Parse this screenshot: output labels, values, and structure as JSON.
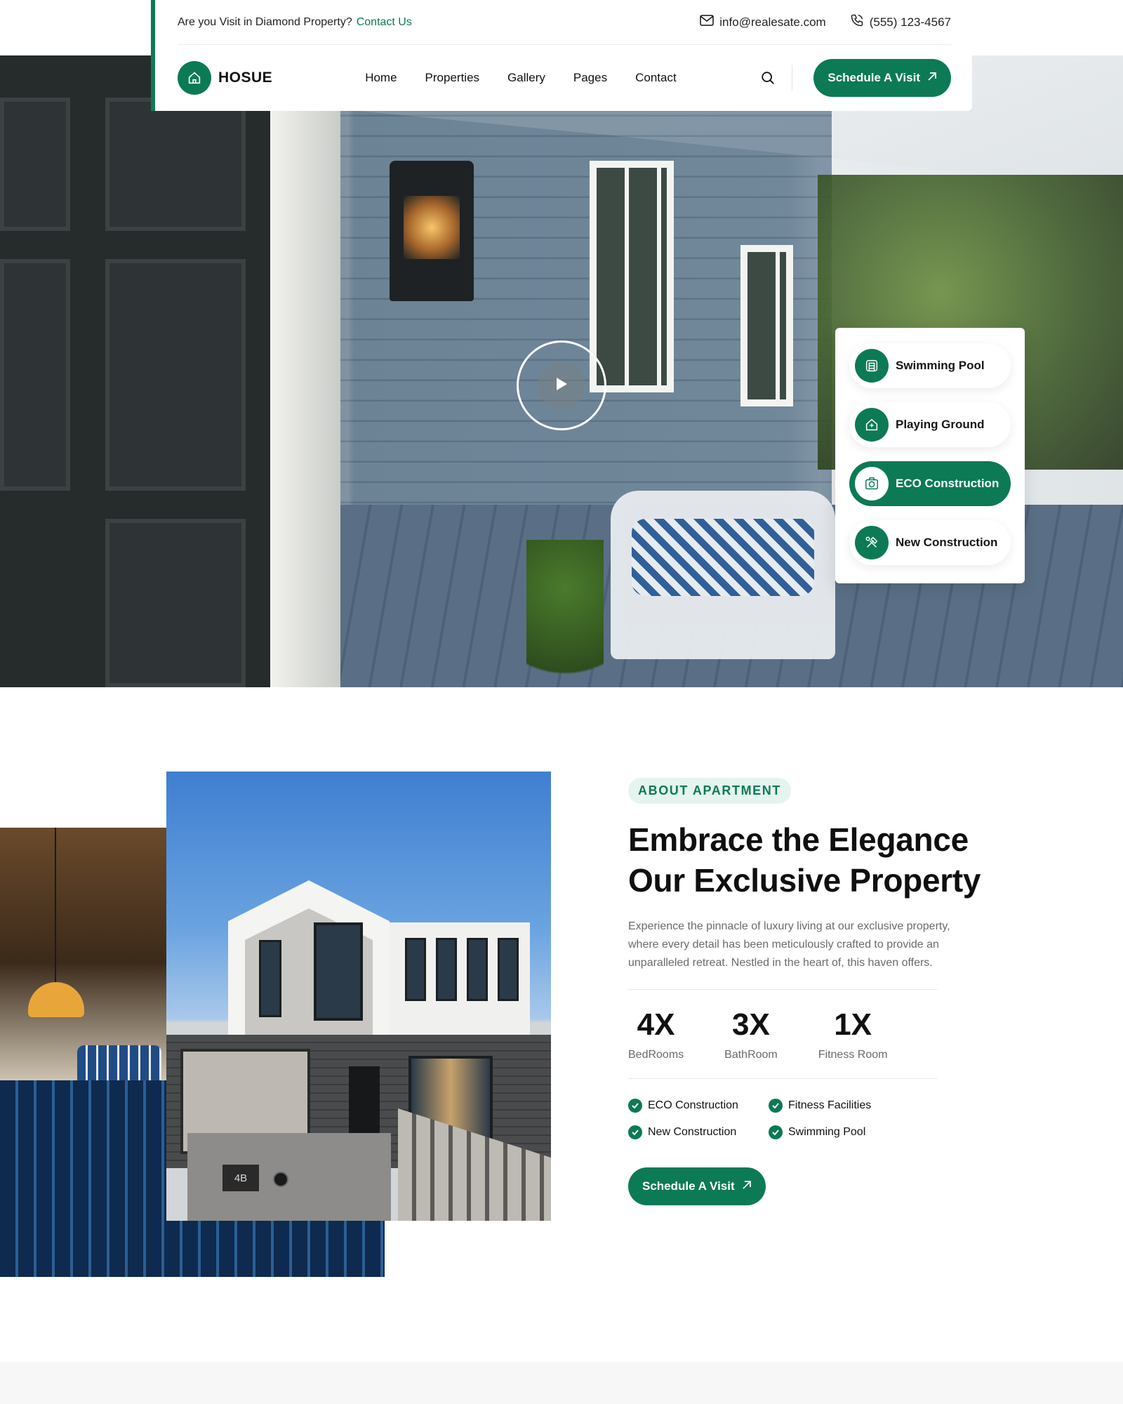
{
  "topbar": {
    "question": "Are you Visit in Diamond Property?",
    "contact_link": "Contact Us",
    "email": "info@realesate.com",
    "phone": "(555) 123-4567"
  },
  "header": {
    "logo_text": "HOSUE",
    "nav": [
      "Home",
      "Properties",
      "Gallery",
      "Pages",
      "Contact"
    ],
    "cta": "Schedule A Visit"
  },
  "hero": {
    "features": [
      {
        "label": "Swimming Pool",
        "icon": "building-icon",
        "active": false
      },
      {
        "label": "Playing Ground",
        "icon": "house-plus-icon",
        "active": false
      },
      {
        "label": "ECO Construction",
        "icon": "camera-box-icon",
        "active": true
      },
      {
        "label": "New Construction",
        "icon": "tools-icon",
        "active": false
      }
    ]
  },
  "about": {
    "badge": "ABOUT APARTMENT",
    "title_line1": "Embrace the Elegance",
    "title_line2": "Our Exclusive Property",
    "description": "Experience the pinnacle of luxury living at our exclusive property, where every detail has been meticulously crafted to provide an unparalleled retreat. Nestled in the heart of, this haven offers.",
    "stats": [
      {
        "value": "4X",
        "label": "BedRooms"
      },
      {
        "value": "3X",
        "label": "BathRoom"
      },
      {
        "value": "1X",
        "label": "Fitness Room"
      }
    ],
    "checks": [
      "ECO Construction",
      "Fitness Facilities",
      "New Construction",
      "Swimming Pool"
    ],
    "cta": "Schedule A Visit",
    "mailbox_number": "4B"
  },
  "colors": {
    "accent": "#0c7a55",
    "badge_bg": "#e5f4ee"
  }
}
